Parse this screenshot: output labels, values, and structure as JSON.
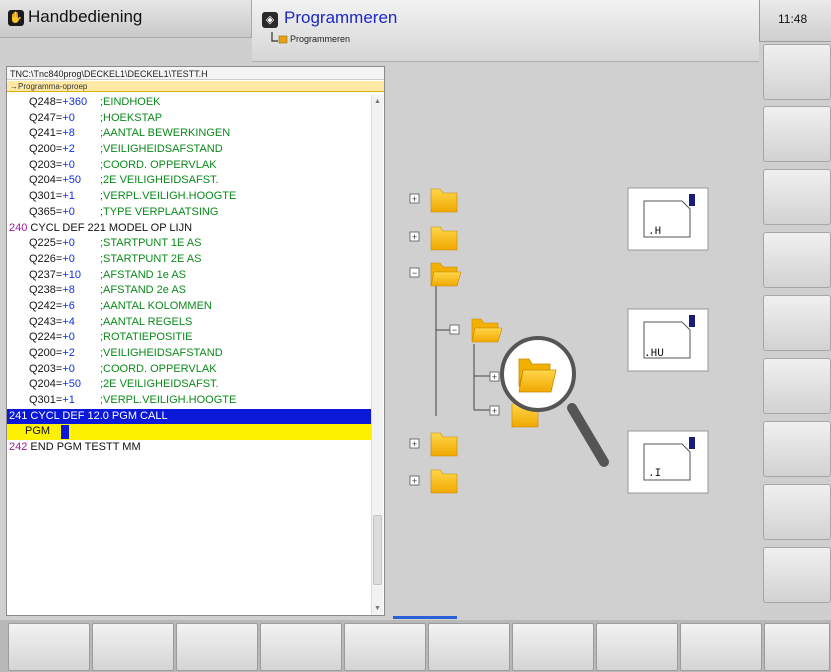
{
  "header": {
    "mode_machine": {
      "label": "Handbediening",
      "icon": "hand-icon"
    },
    "mode_program": {
      "label": "Programmeren",
      "icon": "program-diamond-icon",
      "sub_label": "Programmeren",
      "sub_icon": "folder-path-icon"
    },
    "clock": "11:48"
  },
  "editor": {
    "path": "TNC:\\Tnc840prog\\DECKEL1\\DECKEL1\\TESTT.H",
    "section": "→Programma-oproep",
    "lines": [
      {
        "param": "Q248=",
        "value": "+360",
        "comment": ";EINDHOEK"
      },
      {
        "param": "Q247=",
        "value": "+0",
        "comment": ";HOEKSTAP"
      },
      {
        "param": "Q241=",
        "value": "+8",
        "comment": ";AANTAL BEWERKINGEN"
      },
      {
        "param": "Q200=",
        "value": "+2",
        "comment": ";VEILIGHEIDSAFSTAND"
      },
      {
        "param": "Q203=",
        "value": "+0",
        "comment": ";COORD. OPPERVLAK"
      },
      {
        "param": "Q204=",
        "value": "+50",
        "comment": ";2E VEILIGHEIDSAFST."
      },
      {
        "param": "Q301=",
        "value": "+1",
        "comment": ";VERPL.VEILIGH.HOOGTE"
      },
      {
        "param": "Q365=",
        "value": "+0",
        "comment": ";TYPE VERPLAATSING"
      }
    ],
    "block240": {
      "num": "240",
      "text": "CYCL DEF 221 MODEL OP LIJN"
    },
    "lines2": [
      {
        "param": "Q225=",
        "value": "+0",
        "comment": ";STARTPUNT 1E AS"
      },
      {
        "param": "Q226=",
        "value": "+0",
        "comment": ";STARTPUNT 2E AS"
      },
      {
        "param": "Q237=",
        "value": "+10",
        "comment": ";AFSTAND 1e AS"
      },
      {
        "param": "Q238=",
        "value": "+8",
        "comment": ";AFSTAND 2e AS"
      },
      {
        "param": "Q242=",
        "value": "+6",
        "comment": ";AANTAL KOLOMMEN"
      },
      {
        "param": "Q243=",
        "value": "+4",
        "comment": ";AANTAL REGELS"
      },
      {
        "param": "Q224=",
        "value": "+0",
        "comment": ";ROTATIEPOSITIE"
      },
      {
        "param": "Q200=",
        "value": "+2",
        "comment": ";VEILIGHEIDSAFSTAND"
      },
      {
        "param": "Q203=",
        "value": "+0",
        "comment": ";COORD. OPPERVLAK"
      },
      {
        "param": "Q204=",
        "value": "+50",
        "comment": ";2E VEILIGHEIDSAFST."
      },
      {
        "param": "Q301=",
        "value": "+1",
        "comment": ";VERPL.VEILIGH.HOOGTE"
      }
    ],
    "block241": {
      "num": "241",
      "text": "CYCL DEF 12.0 PGM CALL"
    },
    "pgm_prompt": "PGM",
    "block242": {
      "num": "242",
      "text": "END PGM TESTT MM"
    }
  },
  "illustration": {
    "file_types": [
      ".H",
      ".HU",
      ".I"
    ],
    "icons": [
      "folder-icon",
      "magnifier-icon",
      "tree-expand-icon",
      "tree-collapse-icon"
    ]
  },
  "colors": {
    "selected_line": "#0b18d8",
    "prompt_line": "#fff200",
    "comment": "#0a8a1a",
    "value": "#1030e0",
    "block_number": "#9a1a9a",
    "program_mode": "#1b27c8"
  }
}
